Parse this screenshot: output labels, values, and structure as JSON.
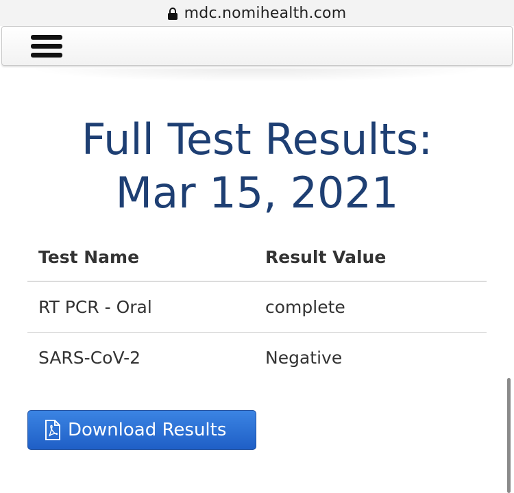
{
  "browser": {
    "url": "mdc.nomihealth.com",
    "lock_icon": "lock-icon"
  },
  "navbar": {
    "menu_icon": "hamburger-menu-icon"
  },
  "page": {
    "title_line1": "Full Test Results:",
    "title_line2": "Mar 15, 2021",
    "title_color": "#1e3f73"
  },
  "results_table": {
    "headers": [
      "Test Name",
      "Result Value"
    ],
    "rows": [
      {
        "test_name": "RT PCR - Oral",
        "result_value": "complete"
      },
      {
        "test_name": "SARS-CoV-2",
        "result_value": "Negative"
      }
    ]
  },
  "download": {
    "label": "Download Results",
    "icon": "pdf-file-icon",
    "color": "#2a6fd6"
  }
}
